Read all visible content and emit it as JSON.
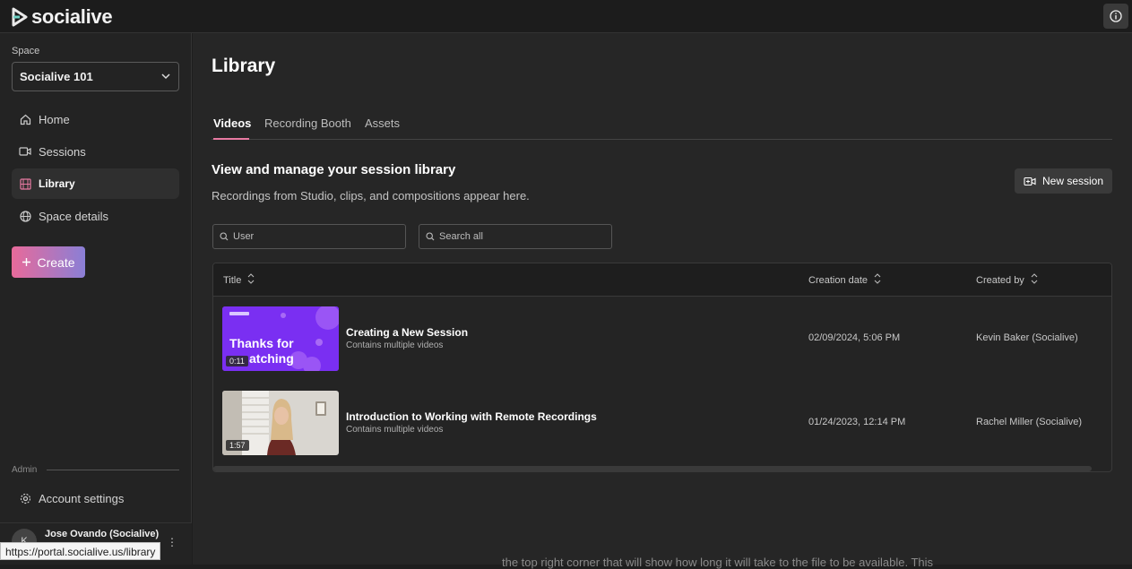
{
  "app": {
    "brand": "socialive"
  },
  "sidebar": {
    "space_label": "Space",
    "space_value": "Socialive 101",
    "items": [
      {
        "label": "Home",
        "icon": "home-icon"
      },
      {
        "label": "Sessions",
        "icon": "video-camera-icon"
      },
      {
        "label": "Library",
        "icon": "film-icon",
        "active": true
      },
      {
        "label": "Space details",
        "icon": "globe-icon"
      }
    ],
    "create_label": "Create",
    "admin_label": "Admin",
    "account_settings": "Account settings",
    "user": {
      "initial": "K",
      "name": "Jose Ovando (Socialive)"
    }
  },
  "status_url": "https://portal.socialive.us/library",
  "main": {
    "title": "Library",
    "tabs": [
      {
        "label": "Videos",
        "active": true
      },
      {
        "label": "Recording Booth"
      },
      {
        "label": "Assets"
      }
    ],
    "section_title": "View and manage your session library",
    "section_sub": "Recordings from Studio, clips, and compositions appear here.",
    "new_session_label": "New session",
    "user_placeholder": "User",
    "search_placeholder": "Search all",
    "table": {
      "headers": [
        "Title",
        "Creation date",
        "Created by"
      ],
      "rows": [
        {
          "title": "Creating a New Session",
          "subtitle": "Contains multiple videos",
          "duration": "0:11",
          "thumb_text_1": "Thanks for",
          "thumb_text_2": "atching",
          "date": "02/09/2024, 5:06 PM",
          "author": "Kevin Baker (Socialive)"
        },
        {
          "title": "Introduction to Working with Remote Recordings",
          "subtitle": "Contains multiple videos",
          "duration": "1:57",
          "date": "01/24/2023, 12:14 PM",
          "author": "Rachel Miller (Socialive)"
        }
      ]
    }
  },
  "bottom_text": "the top right corner that will show how long it will take to the file to be available. This"
}
